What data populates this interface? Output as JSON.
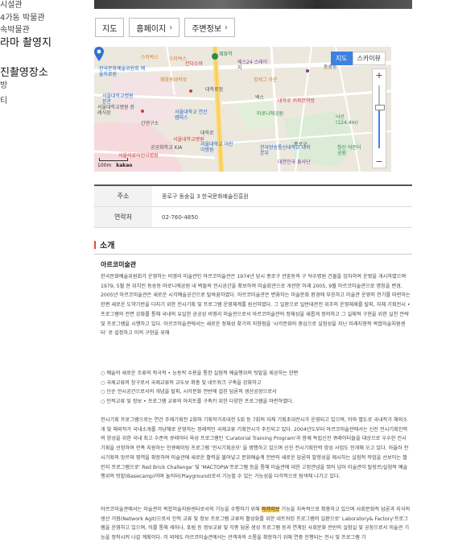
{
  "sidebar": {
    "items": [
      {
        "label": "시설관"
      },
      {
        "label": "4가동 박물관"
      },
      {
        "label": "속박물관"
      },
      {
        "label": "라마 촬영지"
      },
      {
        "label": "진촬영장소"
      },
      {
        "label": "방"
      },
      {
        "label": "티"
      }
    ]
  },
  "buttons": {
    "map": "지도",
    "homepage": "홈페이지",
    "nearby": "주변정보"
  },
  "map": {
    "types": [
      "지도",
      "스카이뷰"
    ],
    "zoom_plus": "+",
    "zoom_minus": "−",
    "logo": "kakao",
    "scale": "100m",
    "labels": [
      "혜화역",
      "스타벅스",
      "스타벅스",
      "메스24 스테이지",
      "칸다소바",
      "혜화동대학로",
      "핫세그 아운",
      "한국문화예술위원회 예술자료원",
      "대학로점",
      "동숭동",
      "서울대학교병원 본관",
      "서울대학교 연건캠퍼스",
      "서울대학교병원 장례식장",
      "간엔구소",
      "대학로",
      "대학로 커피한약방",
      "마로니에공원",
      "한국방송통신대학교 대학본부",
      "서울대학교 어린이병원",
      "서울대학교병원",
      "서울의료어린이병원",
      "공공화학교 KIA",
      "대한민국 흥사단",
      "낙산 (124.4m)",
      "창신 어린이공원",
      "백스",
      "종로구"
    ]
  },
  "info": {
    "address_label": "주소",
    "address_value": "종로구 동숭길 3 한국문화예술진흥원",
    "phone_label": "연락처",
    "phone_value": "02-760-4850"
  },
  "section": {
    "title": "소개",
    "subtitle": "아르코미술관"
  },
  "intro_paragraph": "한국문화예술위원회가 운영하는 비영리 미술관인 아르코미술관은 1974년 당시 종로구 관훈동의 구 덕수병원 건물을 임차하여 운영을 개시하였으며 1979, 5월 현 위치인 동숭동 마로니에공원 내 벽돌의 전시공간을 확보하여 미술회관으로 개관한 이래 2005, 9월 아르코미술관으로 명칭을 변경, 2005년 아르코미술관은 새로운 시각예술공간으로 탈바꿈하였다. 아르코미술관은 변화하는 미술문화 환경에 부응하고 미술관 운영의 전기를 마련하는 한편 새로운 도약기반을 다지기 위한 전시기획 및 프로그램 운영체계를 원선하였다. 그 일환으로 일반대관전 위주의 운영체제를 탈피, 자체 기획전시 • 프로그램의 전면 강화를 통해 국내의 유일한 공공성 비영리 미술관으로서 아르코미술관의 정체성을 새롭게 정의하고 그 실체적 구현을 위한 실천 전략 및 프로그램을 시행하고 있다. 아르코미술관에서는 새로운 정체성 찾기의 지향점을 '시각문화의 중심으로 실험성을 지닌 미래지향적 복합미술지원센터' 로 설정하고 이의 구현을 위해",
  "bullets": [
    "○ 예술의 새로운 조류의 적극적 • 능동적 수용을 통한 실험적 예술행위의 텃밭을 제공하는 한편",
    "○ 국제교류의 창구로서 국제교류의 교두보 확충 및 네트워크 구축을 강화하고",
    "○ 단순 전시공간으로서의 개념을 탈피, 시각문화 전반에 걸친 담론의 생산공장으로서",
    "○ 인적교류 및 정보 • 프로그램 교류의 아지트를 구축키 위한 다양한 프로그램을 마련하였다."
  ],
  "second_paragraph": "전시기획 프로그램으로는 연간 주제기획전 2회와 기획작가초대전 5회 등 7회의 자체 기획초대전시가 운영되고 있으며, 이와 별도로 국내작가 해외소개 및 해외작가 국내소개를 겨냥해로 운영하는 정례적인 국제교류 기획전시가 추진되고 있다. 2004년도부터 아르코미술관에서는 신진 전시기획인력의 양성을 위한 국내 최고 수준의 큐레이터 육성 프로그램인 'Curatorial Training Program'과 함께 독립신진 큐레이터들을 대상으로 우수한 전시기획을 선정하여 전폭 지원하는 인큐베이팅 프로그램 '전시기획공모' 을 병행하고 있으며 신진 전시기획인력 양성 사업도 전개해 오고 있다. 아울러 전시기획의 장르와 영역을 확장하여 미술관에 새로운 활력을 불어넣고 문화예술계 전반의 새로운 담론의 발향성을 제시하는 실험적 작업을 선보이는 챌린지 프로그램으로' Red Brick Challenge' 및 'MACTOPIA'프로그램 등을 통해 미술관에 대한 고정관념을 뛰어 넘어 미술관이 탈장르/실험적 예술행위의 텃밭(Basecamp)이며 놀이터(Playground)로서 기능할 수 있는 가능성을 다각적으로 탐색해 나가고 있다.",
  "third_paragraph_pre": "아르코미술관에서는 미술관이 복합미술지원센터로서의 기능을 수행하기 위해",
  "third_paragraph_highlight": "아카이브",
  "third_paragraph_post": "기능을 지속적으로 확충하고 있으며 사회문화적 담론과 지식의 생산 거점(Network Agit)으로서 인적 교류 및 정보 프로그램 교류의 활성화를 위한 네트워킹 프로그램의 일환으로' Laboratory& Factory'프로그램을 운영하고 있으며, 이를 통해 세미나, 포럼 등 정보교류 및 각종 담론 생성 프로그램 등과 연계된 사회문화 전반의 실험실 및 공장으로서 미술관 기능을 정착시켜 나갈 계획이다. 이 외에도 아르코미술관에서는 관객과의 소통을 확장하기 위해 연중 진행되는 전시 및 프로그램 기"
}
